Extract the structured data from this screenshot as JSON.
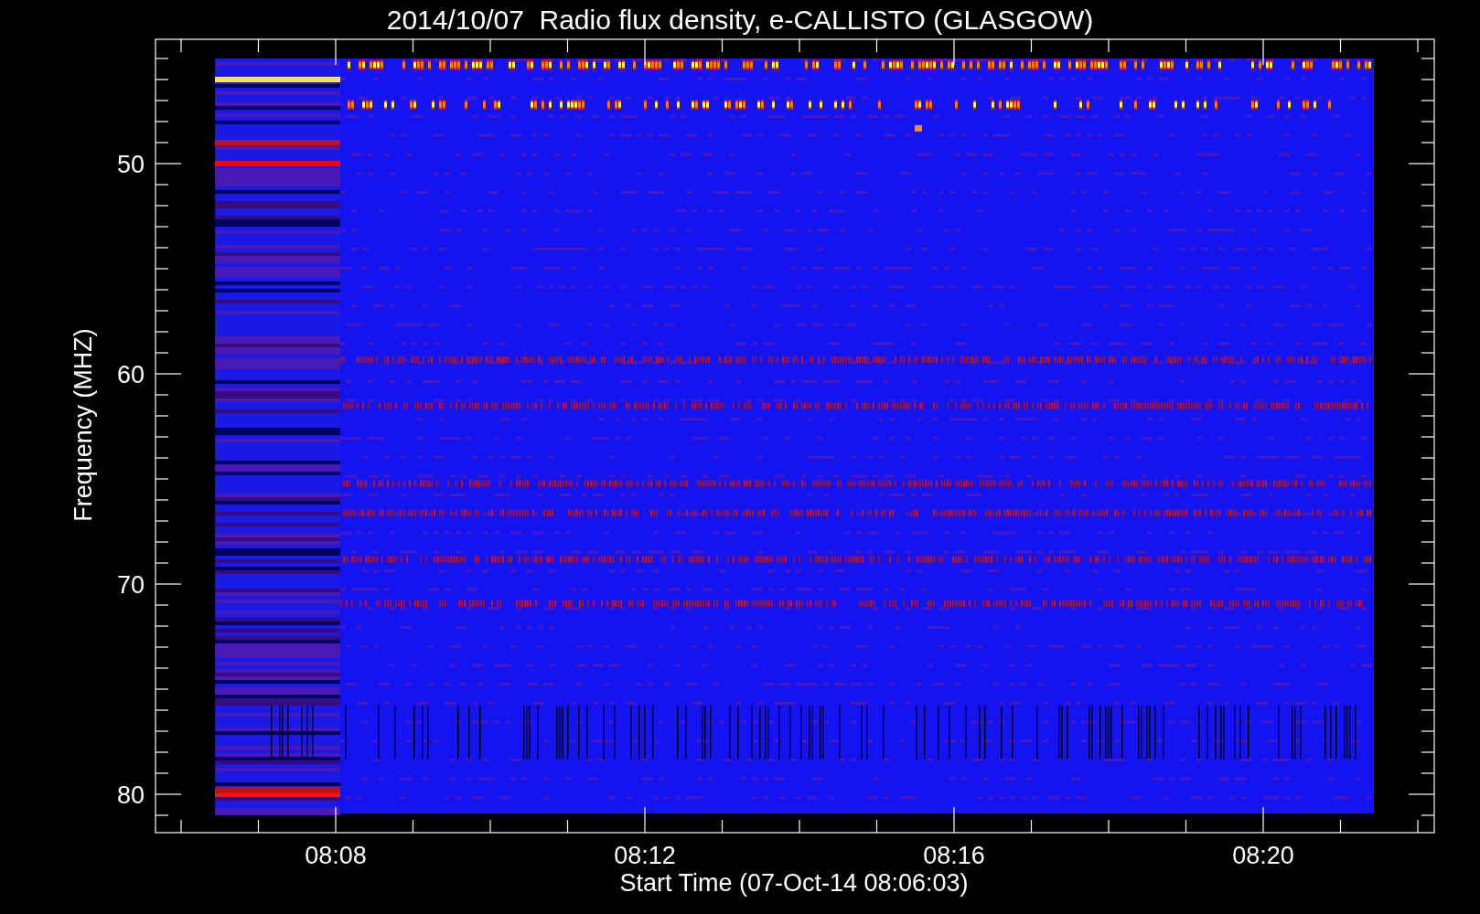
{
  "title": "2014/10/07  Radio flux density, e-CALLISTO (GLASGOW)",
  "y_axis": {
    "label": "Frequency (MHZ)",
    "ticks": [
      "50",
      "60",
      "70",
      "80"
    ]
  },
  "x_axis": {
    "label": "Start Time (07-Oct-14 08:06:03)",
    "ticks": [
      "08:08",
      "08:12",
      "08:16",
      "08:20"
    ]
  }
}
